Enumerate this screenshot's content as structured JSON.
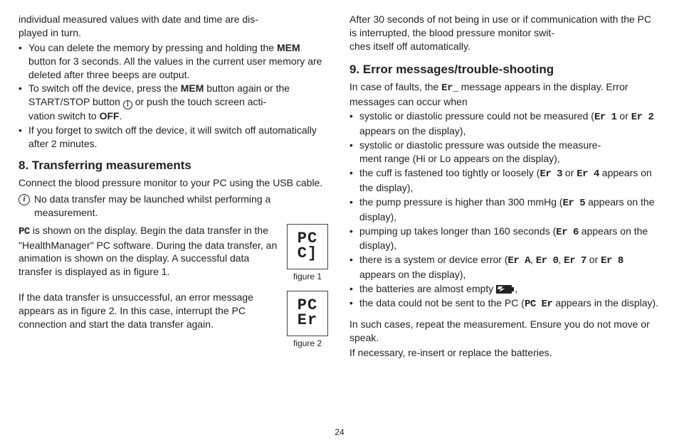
{
  "page_number": "24",
  "left": {
    "intro_cont": {
      "line1": "individual measured values with date and time are dis-",
      "line2": "played in turn."
    },
    "bullets_a": {
      "i0": {
        "p1": "You can delete the memory by pressing and holding the ",
        "mem": "MEM",
        "p2": " button for 3 seconds. All the values in the current user memory are deleted after three beeps are output."
      },
      "i1": {
        "p1": "To switch off the device, press the ",
        "mem": "MEM",
        "p2": " button again or the START/STOP button ",
        "p3": " or push the touch screen acti-",
        "p4": "vation switch to ",
        "off": "OFF",
        "p5": "."
      },
      "i2": "If you forget to switch off the device, it will switch off automatically after 2 minutes."
    },
    "h_transfer": "8. Transferring measurements",
    "transfer_intro": "Connect the blood pressure monitor to your PC using the USB cable.",
    "info_note": "No data transfer may be launched whilst performing a measurement.",
    "pc_symbol": "PC",
    "para_pc": " is shown on the display. Begin the data transfer in the \"HealthManager\" PC software. During the data transfer, an animation is shown on the display. A successful data transfer is displayed as in figure 1.",
    "para_err": "If the data transfer is unsuccessful, an error message appears as in figure 2. In this case, interrupt the PC connection and start the data transfer again.",
    "fig1": {
      "l1": "PC",
      "l2": "C]",
      "cap": "figure 1"
    },
    "fig2": {
      "l1": "PC",
      "l2": "Er",
      "cap": "figure 2"
    }
  },
  "right": {
    "auto_off": "After 30 seconds of not being in use or if communication with the PC is interrupted, the blood pressure monitor swit-",
    "auto_off2": "ches itself off automatically.",
    "h_err": "9. Error messages/trouble-shooting",
    "err_intro1": "In case of faults, the ",
    "er_generic": "Er_",
    "err_intro2": " message appears in the display. Error messages can occur when",
    "bullets_b": {
      "i0": {
        "p1": "systolic or diastolic pressure could not be measured (",
        "c1": "Er 1",
        "p2": " or ",
        "c2": "Er 2",
        "p3": " appears on the display),"
      },
      "i1": {
        "p1": "systolic or diastolic pressure was outside the measure-",
        "p2": "ment range (",
        "c1": "Hi",
        "p3": " or ",
        "c2": "Lo",
        "p4": " appears on the display),"
      },
      "i2": {
        "p1": "the cuff is fastened too tightly or loosely (",
        "c1": "Er 3",
        "p2": " or ",
        "c2": "Er 4",
        "p3": " appears on the display),"
      },
      "i3": {
        "p1": "the pump pressure is higher than 300 mmHg (",
        "c1": "Er 5",
        "p2": " appears on the display),"
      },
      "i4": {
        "p1": "pumping up takes longer than 160 seconds (",
        "c1": "Er 6",
        "p2": " appears on the display),"
      },
      "i5": {
        "p1": "there is a system or device error (",
        "c1": "Er A",
        "p2": ", ",
        "c2": "Er 0",
        "p3": ", ",
        "c3": "Er 7",
        "p4": " or ",
        "c4": "Er 8",
        "p5": " appears on the display),"
      },
      "i6": {
        "p1": "the batteries are almost empty ",
        "p2": ","
      },
      "i7": {
        "p1": "the data could not be sent to the PC (",
        "c1": "PC Er",
        "p2": " appears in the display)."
      }
    },
    "closing1": "In such cases, repeat the measurement. Ensure you do not move or speak.",
    "closing2": "If necessary, re-insert or replace the batteries."
  }
}
